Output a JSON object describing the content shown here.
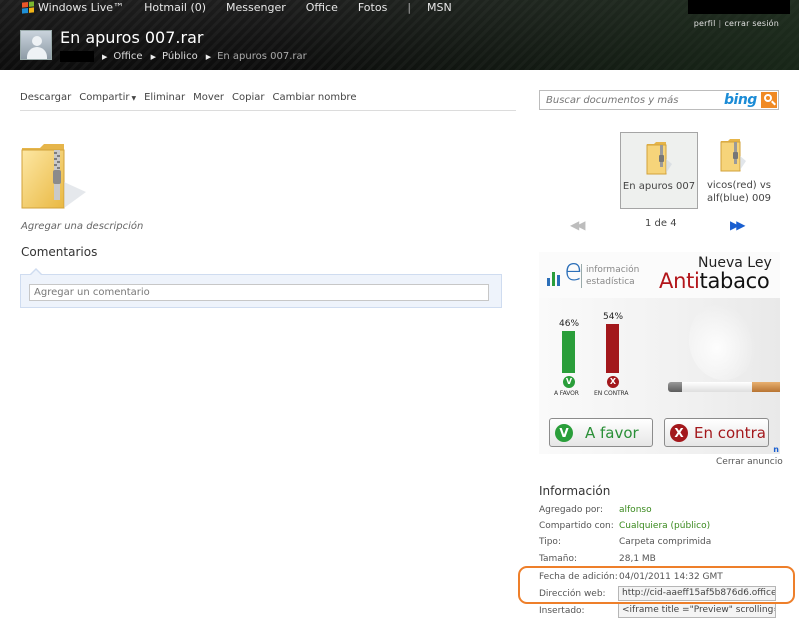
{
  "header": {
    "brand": "Windows Live™",
    "nav": [
      "Hotmail (0)",
      "Messenger",
      "Office",
      "Fotos"
    ],
    "nav_sep": "|",
    "nav_last": "MSN",
    "account_profile": "perfil",
    "account_sep": "|",
    "account_signout": "cerrar sesión",
    "title": "En apuros 007.rar",
    "breadcrumb": [
      "Office",
      "Público",
      "En apuros 007.rar"
    ]
  },
  "toolbar": {
    "download": "Descargar",
    "share": "Compartir",
    "delete": "Eliminar",
    "move": "Mover",
    "copy": "Copiar",
    "rename": "Cambiar nombre"
  },
  "search": {
    "placeholder": "Buscar documentos y más",
    "engine": "bing"
  },
  "file": {
    "description_link": "Agregar una descripción"
  },
  "comments": {
    "title": "Comentarios",
    "placeholder": "Agregar un comentario"
  },
  "thumbnails": [
    {
      "label": "En apuros 007",
      "selected": true
    },
    {
      "label": "vicos(red) vs alf(blue) 009",
      "selected": false
    }
  ],
  "pager": {
    "prev": "◀◀",
    "count": "1 de 4",
    "next": "▶▶"
  },
  "ad": {
    "ie_logo": "e",
    "ie_line1": "información",
    "ie_line2": "estadística",
    "headline1": "Nueva Ley",
    "headline2_a": "Anti",
    "headline2_b": "tabaco",
    "favor_pct": "46%",
    "contra_pct": "54%",
    "favor_level": 0.46,
    "contra_level": 0.54,
    "favor_small": "A FAVOR",
    "contra_small": "EN CONTRA",
    "favor_btn": "A favor",
    "contra_btn": "En contra",
    "check_icon": "V",
    "x_icon": "X",
    "corner": "n",
    "close": "Cerrar anuncio"
  },
  "info": {
    "title": "Información",
    "added_by_label": "Agregado por:",
    "added_by": "alfonso",
    "shared_label": "Compartido con:",
    "shared": "Cualquiera (público)",
    "type_label": "Tipo:",
    "type": "Carpeta comprimida",
    "size_label": "Tamaño:",
    "size": "28,1 MB",
    "date_label": "Fecha de adición:",
    "date": "04/01/2011 14:32 GMT",
    "url_label": "Dirección web:",
    "url": "http://cid-aaeff15af5b876d6.office",
    "embed_label": "Insertado:",
    "embed": "<iframe title =\"Preview\" scrolling=\""
  },
  "colors": {
    "header_bg": "#111111",
    "link_green": "#3a8a1e",
    "favor_green": "#2a9e3a",
    "contra_red": "#a3181c",
    "highlight_orange": "#ee7f2a",
    "bing_blue": "#1c8cd6"
  }
}
